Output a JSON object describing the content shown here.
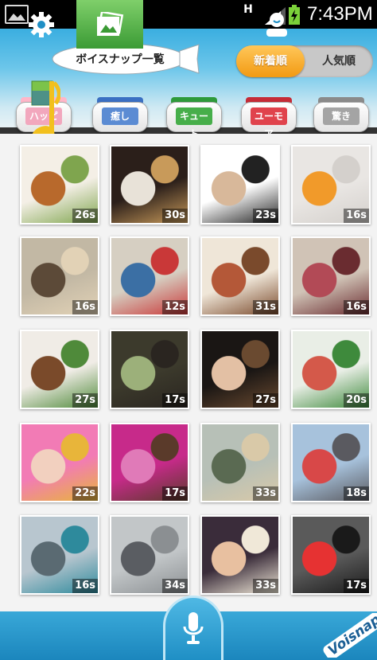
{
  "status_bar": {
    "network_type": "H",
    "time": "7:43PM",
    "icons": [
      "image-notification-icon",
      "signal-icon",
      "battery-charging-icon"
    ]
  },
  "header": {
    "title": "ボイスナップ一覧",
    "sort_tabs": [
      {
        "label": "新着順",
        "selected": true
      },
      {
        "label": "人気順",
        "selected": false
      }
    ]
  },
  "categories": [
    {
      "label": "ハッピー",
      "color": "#f2a7bd",
      "lid": "#ffb6c8",
      "active": true
    },
    {
      "label": "癒し",
      "color": "#5b8bd3",
      "lid": "#3a6fc2",
      "active": false
    },
    {
      "label": "キュート",
      "color": "#47ae4a",
      "lid": "#2e9a3a",
      "active": false
    },
    {
      "label": "ユーモア",
      "color": "#e0434c",
      "lid": "#c62b36",
      "active": false
    },
    {
      "label": "驚き",
      "color": "#a4a4a4",
      "lid": "#8a8a8a",
      "active": false
    }
  ],
  "photos": [
    {
      "duration": "26s",
      "colors": [
        "#f4efe6",
        "#b8692c",
        "#7fa54e"
      ]
    },
    {
      "duration": "30s",
      "colors": [
        "#2b1f1a",
        "#e8e2d8",
        "#c89a5a"
      ]
    },
    {
      "duration": "23s",
      "colors": [
        "#ffffff",
        "#d8b89a",
        "#222222"
      ]
    },
    {
      "duration": "16s",
      "colors": [
        "#e9e6e3",
        "#f19a2a",
        "#d4d0cc"
      ]
    },
    {
      "duration": "16s",
      "colors": [
        "#c2b8a4",
        "#5c4a38",
        "#e2d2b6"
      ]
    },
    {
      "duration": "12s",
      "colors": [
        "#d6cfc2",
        "#3b6fa4",
        "#c93838"
      ]
    },
    {
      "duration": "31s",
      "colors": [
        "#efe6d8",
        "#b45838",
        "#7a4a2c"
      ]
    },
    {
      "duration": "16s",
      "colors": [
        "#d0c3b6",
        "#b24a56",
        "#6a2c30"
      ]
    },
    {
      "duration": "27s",
      "colors": [
        "#f0ece6",
        "#7a4a2a",
        "#4f8a3a"
      ]
    },
    {
      "duration": "17s",
      "colors": [
        "#3c3a2c",
        "#9cb07a",
        "#2a2520"
      ]
    },
    {
      "duration": "27s",
      "colors": [
        "#1a1614",
        "#e3c0a4",
        "#6a4a30"
      ]
    },
    {
      "duration": "20s",
      "colors": [
        "#e9eee6",
        "#d4594a",
        "#3e8a3c"
      ]
    },
    {
      "duration": "22s",
      "colors": [
        "#f27bb5",
        "#f2d0bf",
        "#e8b53a"
      ]
    },
    {
      "duration": "17s",
      "colors": [
        "#c72a8a",
        "#e07ab8",
        "#5a3a2a"
      ]
    },
    {
      "duration": "33s",
      "colors": [
        "#b7c0b7",
        "#5a6a52",
        "#d9c9a8"
      ]
    },
    {
      "duration": "18s",
      "colors": [
        "#a7c2dc",
        "#d84848",
        "#5a5a60"
      ]
    },
    {
      "duration": "16s",
      "colors": [
        "#b8c6cf",
        "#5a6a72",
        "#2e8a9c"
      ]
    },
    {
      "duration": "34s",
      "colors": [
        "#c2c6c8",
        "#5a5d62",
        "#8b8f92"
      ]
    },
    {
      "duration": "33s",
      "colors": [
        "#3a2c3a",
        "#e8c0a0",
        "#f0e8d8"
      ]
    },
    {
      "duration": "17s",
      "colors": [
        "#5a5a5a",
        "#e63232",
        "#1a1a1a"
      ]
    }
  ],
  "bottom_bar": {
    "items": [
      {
        "name": "settings-gear-icon",
        "active": false
      },
      {
        "name": "gallery-photos-icon",
        "active": true
      },
      {
        "name": "microphone-icon",
        "active": false
      },
      {
        "name": "profile-icon",
        "active": false
      }
    ],
    "logo_text": "Voisnap"
  }
}
